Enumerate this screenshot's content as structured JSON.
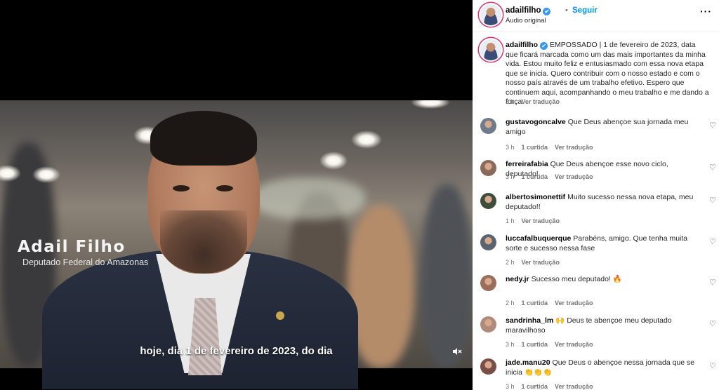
{
  "video": {
    "name_overlay": "Adail Filho",
    "role_overlay": "Deputado Federal do Amazonas",
    "subtitle": "hoje, dia 1 de fevereiro de 2023, do dia",
    "mute_icon": "speaker-muted-icon"
  },
  "header": {
    "username": "adailfilho",
    "verified_icon": "✔",
    "dot": "•",
    "follow_label": "Seguir",
    "audio_label": "Áudio original",
    "more_label": "···"
  },
  "caption": {
    "username": "adailfilho",
    "text": "EMPOSSADO | 1 de fevereiro de 2023, data que ficará marcada como um das mais importantes da minha vida. Estou muito feliz e entusiasmado com essa nova etapa que se inicia. Quero contribuir com o nosso estado e com o nosso país através de um trabalho efetivo. Espero que continuem aqui, acompanhando o meu trabalho e me dando a força.",
    "time": "3 h",
    "translate": "Ver tradução"
  },
  "comments": [
    {
      "user": "gustavogoncalve",
      "text": "Que Deus abençoe sua jornada meu amigo",
      "time": "3 h",
      "likes": "1 curtida",
      "translate": "Ver tradução",
      "avatar_color": "#6d7b8a"
    },
    {
      "user": "ferreirafabia",
      "text": "Que Deus abençoe esse novo ciclo, deputado!",
      "time": "3 h",
      "likes": "1 curtida",
      "translate": "Ver tradução",
      "avatar_color": "#8a6a58"
    },
    {
      "user": "albertosimonettif",
      "text": "Muito sucesso nessa nova etapa, meu deputado!!",
      "time": "1 h",
      "likes": "",
      "translate": "Ver tradução",
      "avatar_color": "#3e4d3a"
    },
    {
      "user": "luccafalbuquerque",
      "text": "Parabéns, amigo. Que tenha muita sorte e sucesso nessa fase",
      "time": "2 h",
      "likes": "",
      "translate": "Ver tradução",
      "avatar_color": "#5a6470"
    },
    {
      "user": "nedy.jr",
      "text": "Sucesso meu deputado! 🔥",
      "time": "2 h",
      "likes": "1 curtida",
      "translate": "Ver tradução",
      "avatar_color": "#9a6e5a"
    },
    {
      "user": "sandrinha_lm",
      "text": "🙌 Deus te abençoe meu deputado maravilhoso",
      "time": "3 h",
      "likes": "1 curtida",
      "translate": "Ver tradução",
      "avatar_color": "#b08a7a"
    },
    {
      "user": "jade.manu20",
      "text": "Que Deus o abençoe nessa jornada que se inicia 👏👏👏",
      "time": "3 h",
      "likes": "1 curtida",
      "translate": "Ver tradução",
      "avatar_color": "#7a4e44"
    }
  ],
  "like_icon": "♡"
}
